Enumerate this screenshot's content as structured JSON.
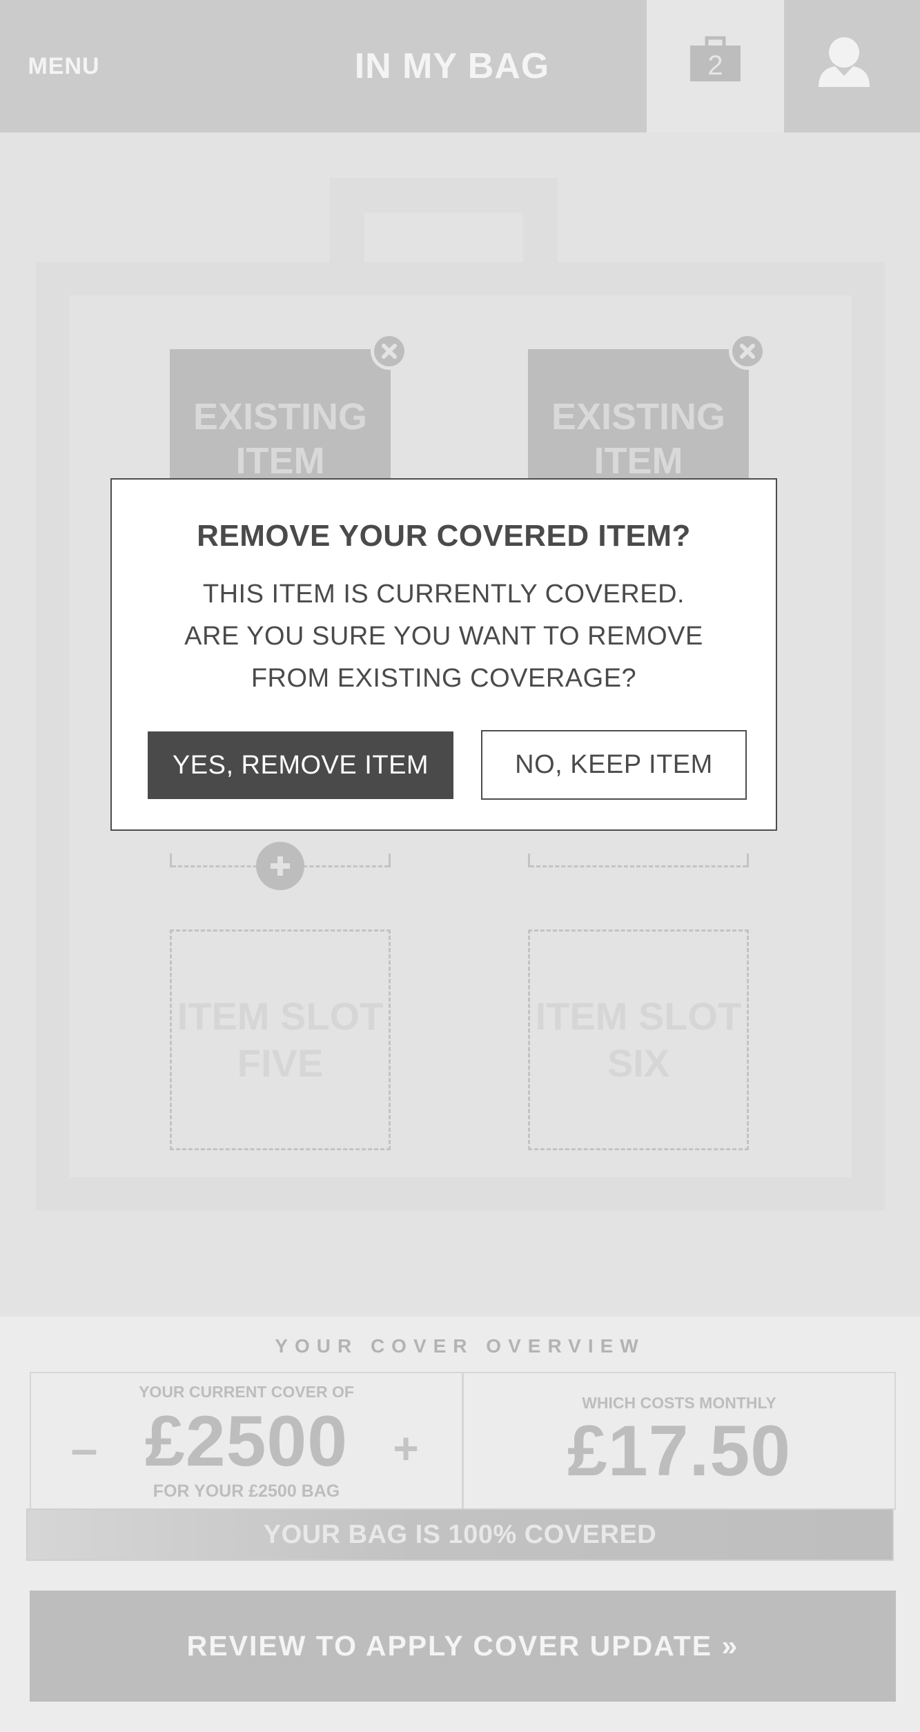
{
  "header": {
    "menu_label": "MENU",
    "title": "IN MY BAG",
    "bag_count": "2",
    "bag_icon": "briefcase-icon",
    "user_icon": "user-icon"
  },
  "bag": {
    "items": [
      {
        "label": "EXISTING ITEM"
      },
      {
        "label": "EXISTING ITEM"
      }
    ],
    "slots": [
      {
        "label": "ITEM SLOT FIVE"
      },
      {
        "label": "ITEM SLOT SIX"
      }
    ]
  },
  "modal": {
    "title": "REMOVE YOUR COVERED ITEM?",
    "body_line1": "THIS ITEM IS CURRENTLY COVERED.",
    "body_line2": "ARE YOU SURE YOU WANT TO REMOVE",
    "body_line3": "FROM EXISTING COVERAGE?",
    "confirm_label": "YES, REMOVE ITEM",
    "cancel_label": "NO, KEEP ITEM"
  },
  "overview": {
    "heading": "YOUR COVER OVERVIEW",
    "cover_label": "YOUR CURRENT COVER OF",
    "cover_value": "£2500",
    "cover_sub": "FOR YOUR £2500 BAG",
    "decrease_label": "–",
    "increase_label": "+",
    "cost_label": "WHICH COSTS MONTHLY",
    "cost_value": "£17.50",
    "status": "YOUR BAG IS 100% COVERED",
    "cta_label": "REVIEW TO APPLY COVER UPDATE »"
  },
  "colors": {
    "header_bg": "#cbcbcb",
    "page_bg": "#e3e3e3",
    "modal_primary": "#4a4a4a",
    "placeholder_gray": "#bdbdbd"
  }
}
